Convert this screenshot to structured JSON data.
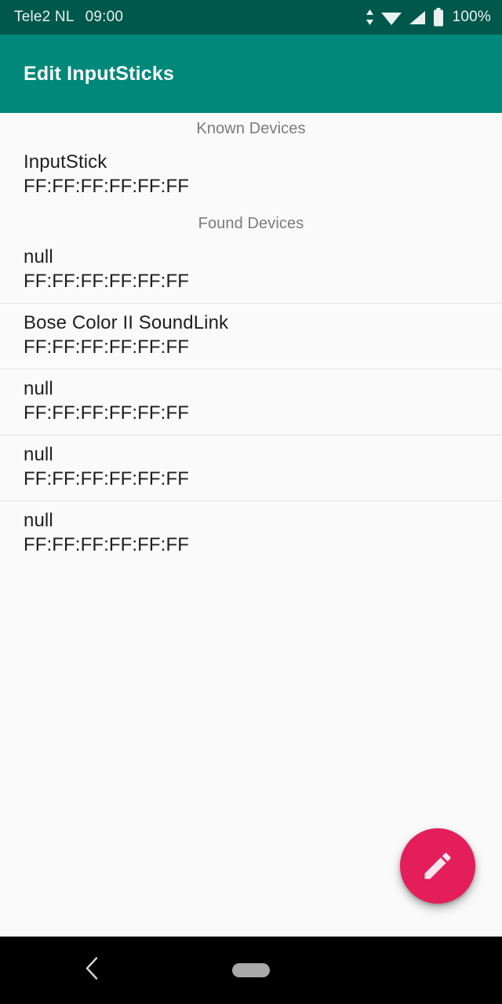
{
  "status_bar": {
    "carrier": "Tele2 NL",
    "time": "09:00",
    "battery_percent": "100%",
    "icons": [
      "data-transfer-icon",
      "wifi-icon",
      "cellular-signal-icon",
      "battery-icon"
    ],
    "background_color": "#00574B",
    "text_color": "#E8F3F0"
  },
  "app_bar": {
    "title": "Edit InputSticks",
    "background_color": "#00897B",
    "title_color": "#FFFFFF"
  },
  "content": {
    "background_color": "#FAFAFA",
    "sections": [
      {
        "header": "Known Devices",
        "devices": [
          {
            "name": "InputStick",
            "address": "FF:FF:FF:FF:FF:FF"
          }
        ]
      },
      {
        "header": "Found Devices",
        "devices": [
          {
            "name": "null",
            "address": "FF:FF:FF:FF:FF:FF"
          },
          {
            "name": "Bose Color II SoundLink",
            "address": "FF:FF:FF:FF:FF:FF"
          },
          {
            "name": "null",
            "address": "FF:FF:FF:FF:FF:FF"
          },
          {
            "name": "null",
            "address": "FF:FF:FF:FF:FF:FF"
          },
          {
            "name": "null",
            "address": "FF:FF:FF:FF:FF:FF"
          }
        ]
      }
    ]
  },
  "fab": {
    "icon": "pencil-edit-icon",
    "background_color": "#E41E5B",
    "icon_color": "#FCE4EC"
  },
  "nav_bar": {
    "background_color": "#000000",
    "buttons": [
      "back-icon",
      "home-pill-icon"
    ]
  }
}
